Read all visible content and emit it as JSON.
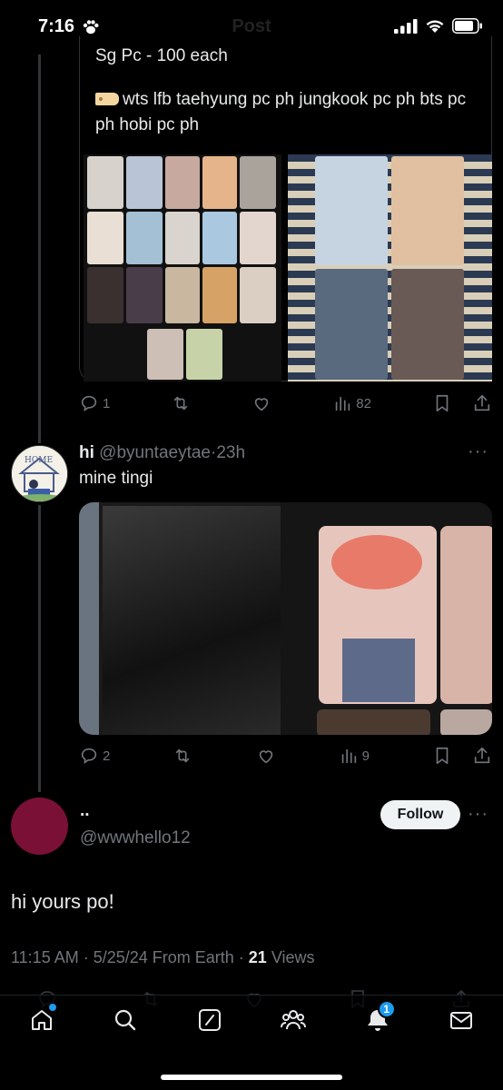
{
  "status_bar": {
    "time": "7:16",
    "ghost_title": "Post",
    "icons": [
      "paw-icon",
      "signal-icon",
      "wifi-icon",
      "battery-icon"
    ]
  },
  "tweet_above": {
    "text_line_cut": "Sg Pc - 100 each",
    "text": "wts lfb taehyung pc ph jungkook pc ph bts pc ph hobi pc ph",
    "tag_icon": "price-tag-icon",
    "stats": {
      "replies": "1",
      "views": "82"
    }
  },
  "reply_tweet": {
    "name": "hi",
    "handle": "@byuntaeytae",
    "time": "23h",
    "text": "mine tingi",
    "avatar_label": "HOME",
    "stats": {
      "replies": "2",
      "views": "9"
    }
  },
  "main_tweet": {
    "name": "..",
    "handle": "@wwwhello12",
    "follow_label": "Follow",
    "text": "hi yours po!",
    "meta_time": "11:15 AM · 5/25/24 From Earth · ",
    "meta_views_count": "21",
    "meta_views_label": " Views"
  },
  "bottom_nav": {
    "items": [
      "home-icon",
      "search-icon",
      "grok-icon",
      "communities-icon",
      "notifications-icon",
      "messages-icon"
    ],
    "notification_count": "1"
  },
  "colors": {
    "background": "#000000",
    "text": "#e7e9ea",
    "muted": "#71767b",
    "accent": "#1d9bf0",
    "avatar_main": "#7a1035"
  }
}
